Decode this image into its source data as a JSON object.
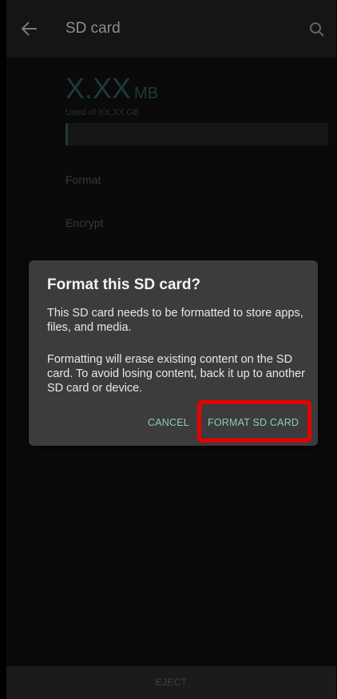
{
  "appbar": {
    "title": "SD card",
    "back_icon": "arrow-left-icon",
    "search_icon": "search-icon"
  },
  "storage": {
    "used_value": "X.XX",
    "unit": "MB",
    "used_of": "Used of XX.XX GB",
    "usage_fraction": 0.01
  },
  "menu": {
    "format": "Format",
    "encrypt": "Encrypt"
  },
  "dialog": {
    "title": "Format this SD card?",
    "message1": "This SD card needs to be formatted to store apps, files, and media.",
    "message2": "Formatting will erase existing content on the SD card. To avoid losing content, back it up to another SD card or device.",
    "cancel": "CANCEL",
    "confirm": "FORMAT SD CARD",
    "highlight_color": "#e60000"
  },
  "bottom": {
    "eject": "EJECT"
  },
  "colors": {
    "accent": "#8fc8c2",
    "dialog_bg": "#3c3c3c",
    "background": "#0a0a0a"
  }
}
